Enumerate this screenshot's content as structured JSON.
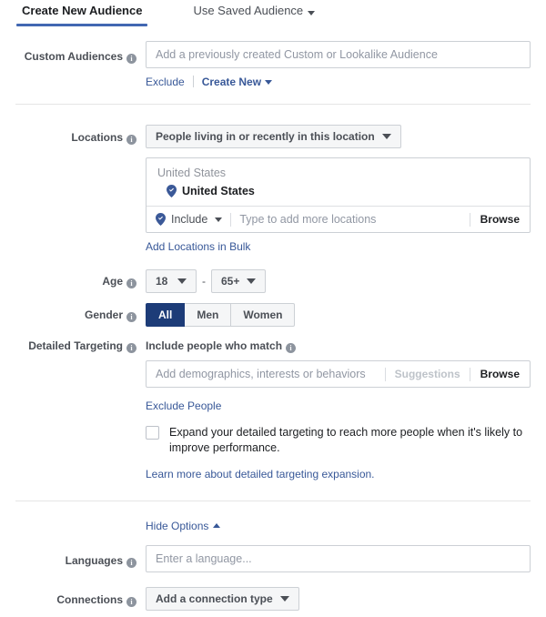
{
  "tabs": {
    "create_new": "Create New Audience",
    "use_saved": "Use Saved Audience"
  },
  "custom_audiences": {
    "label": "Custom Audiences",
    "placeholder": "Add a previously created Custom or Lookalike Audience",
    "value": "",
    "exclude_link": "Exclude",
    "create_new_link": "Create New"
  },
  "locations": {
    "label": "Locations",
    "dropdown_value": "People living in or recently in this location",
    "group_header": "United States",
    "selected_location": "United States",
    "include_label": "Include",
    "input_placeholder": "Type to add more locations",
    "input_value": "",
    "browse_label": "Browse",
    "bulk_link": "Add Locations in Bulk"
  },
  "age": {
    "label": "Age",
    "min": "18",
    "max": "65+",
    "separator": "-"
  },
  "gender": {
    "label": "Gender",
    "options": [
      "All",
      "Men",
      "Women"
    ],
    "selected": "All"
  },
  "detailed_targeting": {
    "label": "Detailed Targeting",
    "include_header": "Include people who match",
    "placeholder": "Add demographics, interests or behaviors",
    "value": "",
    "suggestions_label": "Suggestions",
    "browse_label": "Browse",
    "exclude_link": "Exclude People",
    "expand_checkbox_label": "Expand your detailed targeting to reach more people when it's likely to improve performance.",
    "expand_checked": false,
    "learn_more_link": "Learn more about detailed targeting expansion."
  },
  "options_toggle": {
    "label": "Hide Options"
  },
  "languages": {
    "label": "Languages",
    "placeholder": "Enter a language...",
    "value": ""
  },
  "connections": {
    "label": "Connections",
    "button_label": "Add a connection type"
  },
  "colors": {
    "accent_blue": "#4267b2",
    "link_blue": "#385898",
    "selected_navy": "#1d3c78",
    "pin_blue": "#3b5998",
    "border_gray": "#ccd0d5",
    "label_gray": "#4b4f56",
    "placeholder_gray": "#9197a3"
  }
}
